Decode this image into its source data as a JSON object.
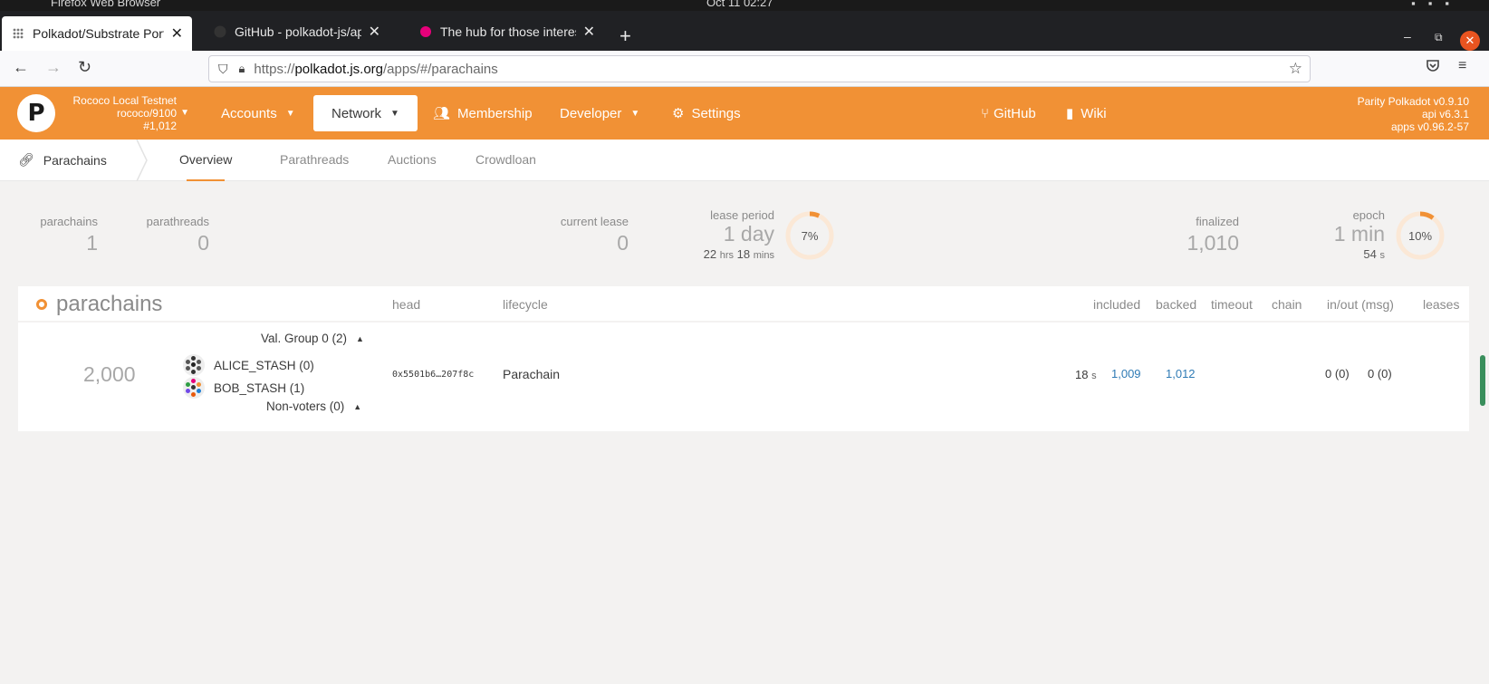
{
  "os": {
    "title": "Firefox Web Browser",
    "clock": "Oct 11  02:27"
  },
  "browser": {
    "tabs": [
      {
        "title": "Polkadot/Substrate Portal",
        "close": "✕"
      },
      {
        "title": "GitHub - polkadot-js/apps",
        "close": "✕"
      },
      {
        "title": "The hub for those interested",
        "close": "✕"
      }
    ],
    "new_tab": "+",
    "url_prefix": "https://",
    "url_domain": "polkadot.js.org",
    "url_path": "/apps/#/parachains"
  },
  "app": {
    "chain": {
      "name": "Rococo Local Testnet",
      "spec": "rococo/9100",
      "block": "#1,012"
    },
    "menu": {
      "accounts": "Accounts",
      "network": "Network",
      "membership": "Membership",
      "developer": "Developer",
      "settings": "Settings",
      "github": "GitHub",
      "wiki": "Wiki"
    },
    "version": {
      "node": "Parity Polkadot v0.9.10",
      "api": "api v6.3.1",
      "apps": "apps v0.96.2-57"
    }
  },
  "subnav": {
    "section": "Parachains",
    "tabs": {
      "overview": "Overview",
      "parathreads": "Parathreads",
      "auctions": "Auctions",
      "crowdloan": "Crowdloan"
    }
  },
  "summary": {
    "parachains": {
      "label": "parachains",
      "value": "1"
    },
    "parathreads": {
      "label": "parathreads",
      "value": "0"
    },
    "current_lease": {
      "label": "current lease",
      "value": "0"
    },
    "lease_period": {
      "label": "lease period",
      "value": "1 day",
      "sub_hrs": "22",
      "sub_hrs_unit": "hrs",
      "sub_mins": "18",
      "sub_mins_unit": "mins",
      "percent": 7,
      "percent_label": "7%"
    },
    "finalized": {
      "label": "finalized",
      "value": "1,010"
    },
    "epoch": {
      "label": "epoch",
      "value": "1 min",
      "sub_secs": "54",
      "sub_secs_unit": "s",
      "percent": 10,
      "percent_label": "10%"
    }
  },
  "table": {
    "title": "parachains",
    "headers": {
      "head": "head",
      "lifecycle": "lifecycle",
      "included": "included",
      "backed": "backed",
      "timeout": "timeout",
      "chain": "chain",
      "inout": "in/out (msg)",
      "leases": "leases"
    },
    "row": {
      "id": "2,000",
      "val_group": "Val. Group 0 (2)",
      "validators": [
        "ALICE_STASH (0)",
        "BOB_STASH (1)"
      ],
      "non_voters": "Non-voters (0)",
      "head": "0x5501b6…207f8c",
      "lifecycle": "Parachain",
      "age": "18",
      "age_unit": "s",
      "included": "1,009",
      "backed": "1,012",
      "in": "0 (0)",
      "out": "0 (0)"
    }
  },
  "colors": {
    "accent": "#f19135",
    "link": "#2f7bb5"
  }
}
